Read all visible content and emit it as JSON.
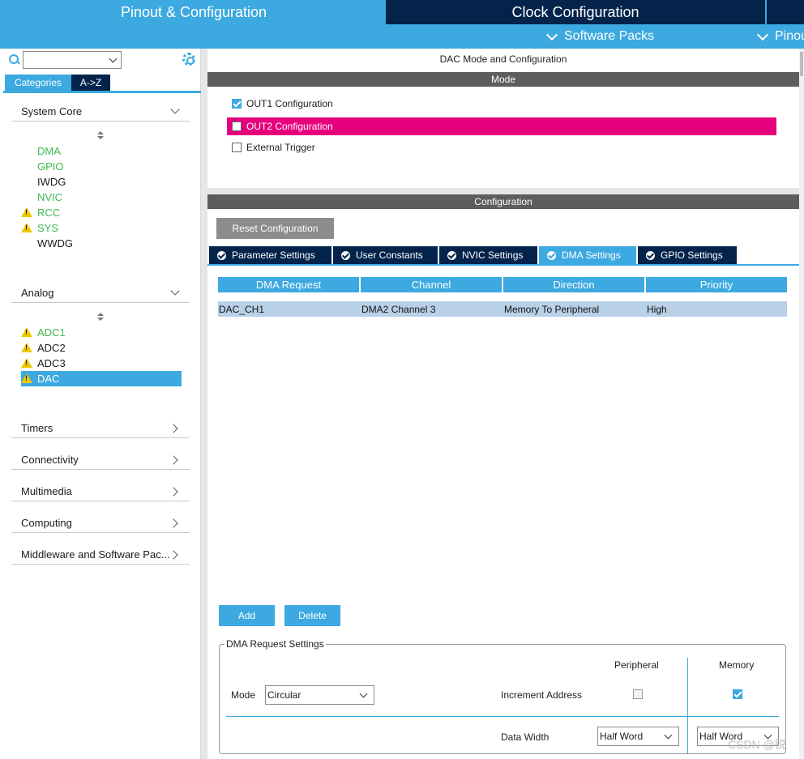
{
  "header": {
    "tab_pinout": "Pinout & Configuration",
    "tab_clock": "Clock Configuration",
    "subtab_software_packs": "Software Packs",
    "subtab_pinout": "Pinout"
  },
  "sidebar": {
    "search_value": "",
    "tab_categories": "Categories",
    "tab_az": "A->Z",
    "system_core": {
      "label": "System Core",
      "items": [
        {
          "label": "DMA",
          "warning": false,
          "color": "#3dba4e"
        },
        {
          "label": "GPIO",
          "warning": false,
          "color": "#3dba4e"
        },
        {
          "label": "IWDG",
          "warning": false,
          "color": "#1b1b1b"
        },
        {
          "label": "NVIC",
          "warning": false,
          "color": "#3dba4e"
        },
        {
          "label": "RCC",
          "warning": true,
          "color": "#3dba4e"
        },
        {
          "label": "SYS",
          "warning": true,
          "color": "#3dba4e"
        },
        {
          "label": "WWDG",
          "warning": false,
          "color": "#1b1b1b"
        }
      ]
    },
    "analog": {
      "label": "Analog",
      "items": [
        {
          "label": "ADC1",
          "warning": true,
          "color": "#3dba4e"
        },
        {
          "label": "ADC2",
          "warning": true,
          "color": "#1b1b1b"
        },
        {
          "label": "ADC3",
          "warning": true,
          "color": "#1b1b1b"
        },
        {
          "label": "DAC",
          "warning": true,
          "selected": true
        }
      ]
    },
    "collapsed": [
      "Timers",
      "Connectivity",
      "Multimedia",
      "Computing",
      "Middleware and Software Pac..."
    ]
  },
  "main": {
    "title": "DAC Mode and Configuration",
    "mode_header": "Mode",
    "mode_options": [
      {
        "label": "OUT1 Configuration",
        "checked": true
      },
      {
        "label": "OUT2 Configuration",
        "checked": false,
        "highlighted": true
      },
      {
        "label": "External Trigger",
        "checked": false
      }
    ],
    "config_header": "Configuration",
    "reset_button": "Reset Configuration",
    "tabs": [
      {
        "label": "Parameter Settings",
        "active": false
      },
      {
        "label": "User Constants",
        "active": false
      },
      {
        "label": "NVIC Settings",
        "active": false
      },
      {
        "label": "DMA Settings",
        "active": true
      },
      {
        "label": "GPIO Settings",
        "active": false
      }
    ],
    "dma_table": {
      "columns": [
        "DMA Request",
        "Channel",
        "Direction",
        "Priority"
      ],
      "rows": [
        [
          "DAC_CH1",
          "DMA2 Channel 3",
          "Memory To Peripheral",
          "High"
        ]
      ]
    },
    "add_button": "Add",
    "delete_button": "Delete",
    "request_settings": {
      "legend": "DMA Request Settings",
      "col_peripheral": "Peripheral",
      "col_memory": "Memory",
      "mode_label": "Mode",
      "mode_value": "Circular",
      "increment_label": "Increment Address",
      "increment_peripheral": false,
      "increment_memory": true,
      "data_width_label": "Data Width",
      "data_width_peripheral": "Half Word",
      "data_width_memory": "Half Word"
    }
  },
  "watermark": "CSDN @锐",
  "colors": {
    "accent": "#3ca9e0",
    "navy": "#03234b",
    "highlight": "#e6007e",
    "ok_green": "#3dba4e",
    "warning": "#f0c800"
  }
}
